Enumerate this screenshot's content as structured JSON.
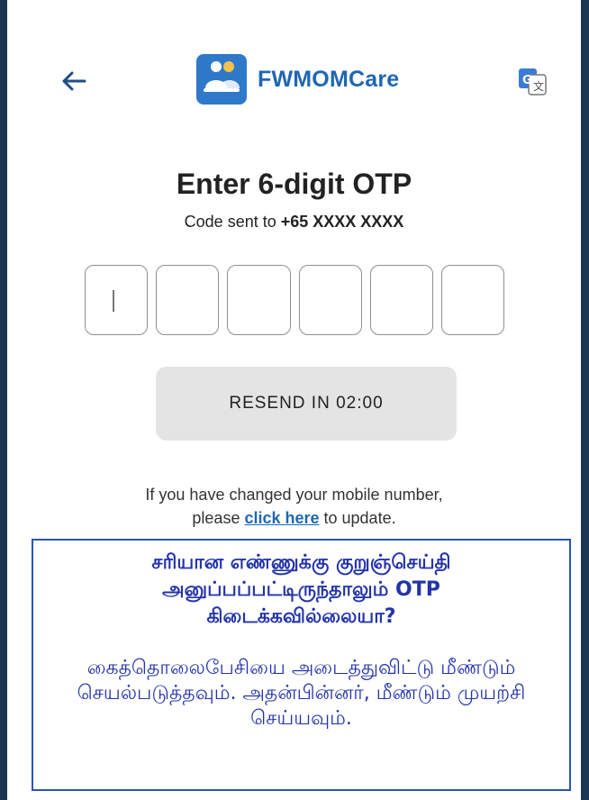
{
  "header": {
    "back_icon": "arrow-left-icon",
    "app_name": "FWMOMCare",
    "logo_icon": "fwmomcare-logo-icon",
    "translate_icon": "google-translate-icon"
  },
  "main": {
    "title": "Enter 6-digit OTP",
    "code_sent_prefix": "Code sent to ",
    "phone_masked": "+65 XXXX XXXX",
    "otp_digits": [
      "",
      "",
      "",
      "",
      "",
      ""
    ],
    "resend_label": "RESEND IN 02:00",
    "note_line1": "If you have changed your mobile number,",
    "note_prefix": "please ",
    "note_link": "click here",
    "note_suffix": " to update."
  },
  "callout": {
    "question": "சரியான எண்ணுக்கு குறுஞ்செய்தி அனுப்பப்பட்டிருந்தாலும் OTP கிடைக்கவில்லையா?",
    "answer": "கைத்தொலைபேசியை அடைத்துவிட்டு மீண்டும் செயல்படுத்தவும். அதன்பின்னர், மீண்டும் முயற்சி செய்யவும்."
  },
  "colors": {
    "brand": "#1e67b3",
    "callout_text": "#2233aa",
    "callout_border": "#2a56b4",
    "frame_border": "#1c3553"
  }
}
